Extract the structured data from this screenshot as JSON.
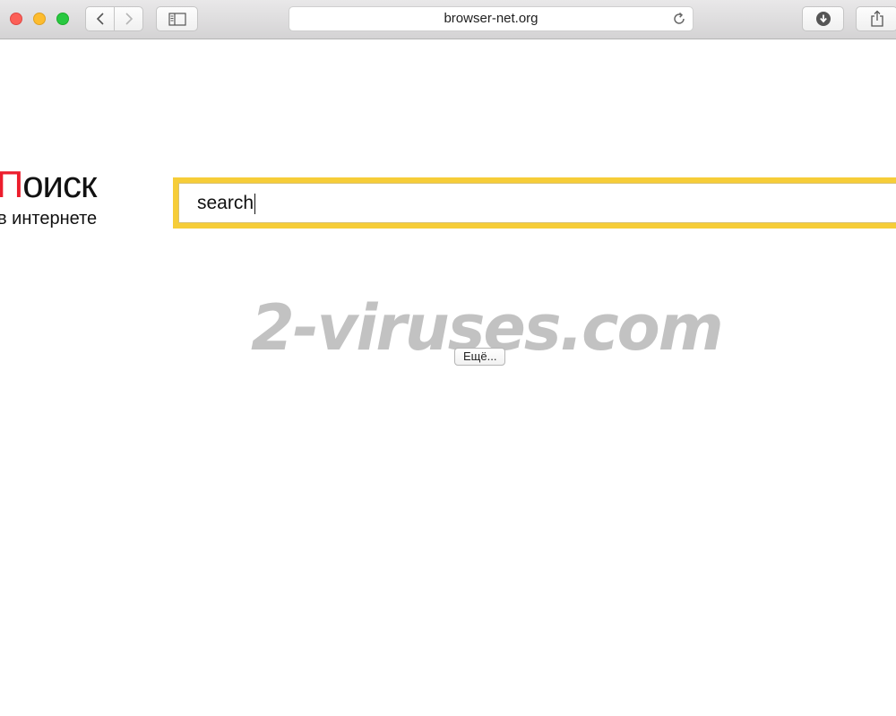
{
  "browser": {
    "url": "browser-net.org",
    "search_input_value": "search"
  },
  "logo": {
    "first_letter": "П",
    "rest": "оиск",
    "subtitle": "в интернете"
  },
  "watermark": "2-viruses.com",
  "more_button_label": "Ещё...",
  "colors": {
    "search_frame": "#f6cd38",
    "logo_accent": "#ec1d2c",
    "traffic_close": "#fc5f57",
    "traffic_minimize": "#fdbc2e",
    "traffic_maximize": "#28c840"
  },
  "icons": {
    "back": "chevron-left-icon",
    "forward": "chevron-right-icon",
    "sidebar": "sidebar-icon",
    "reload": "reload-icon",
    "download": "download-icon",
    "share": "share-icon"
  }
}
